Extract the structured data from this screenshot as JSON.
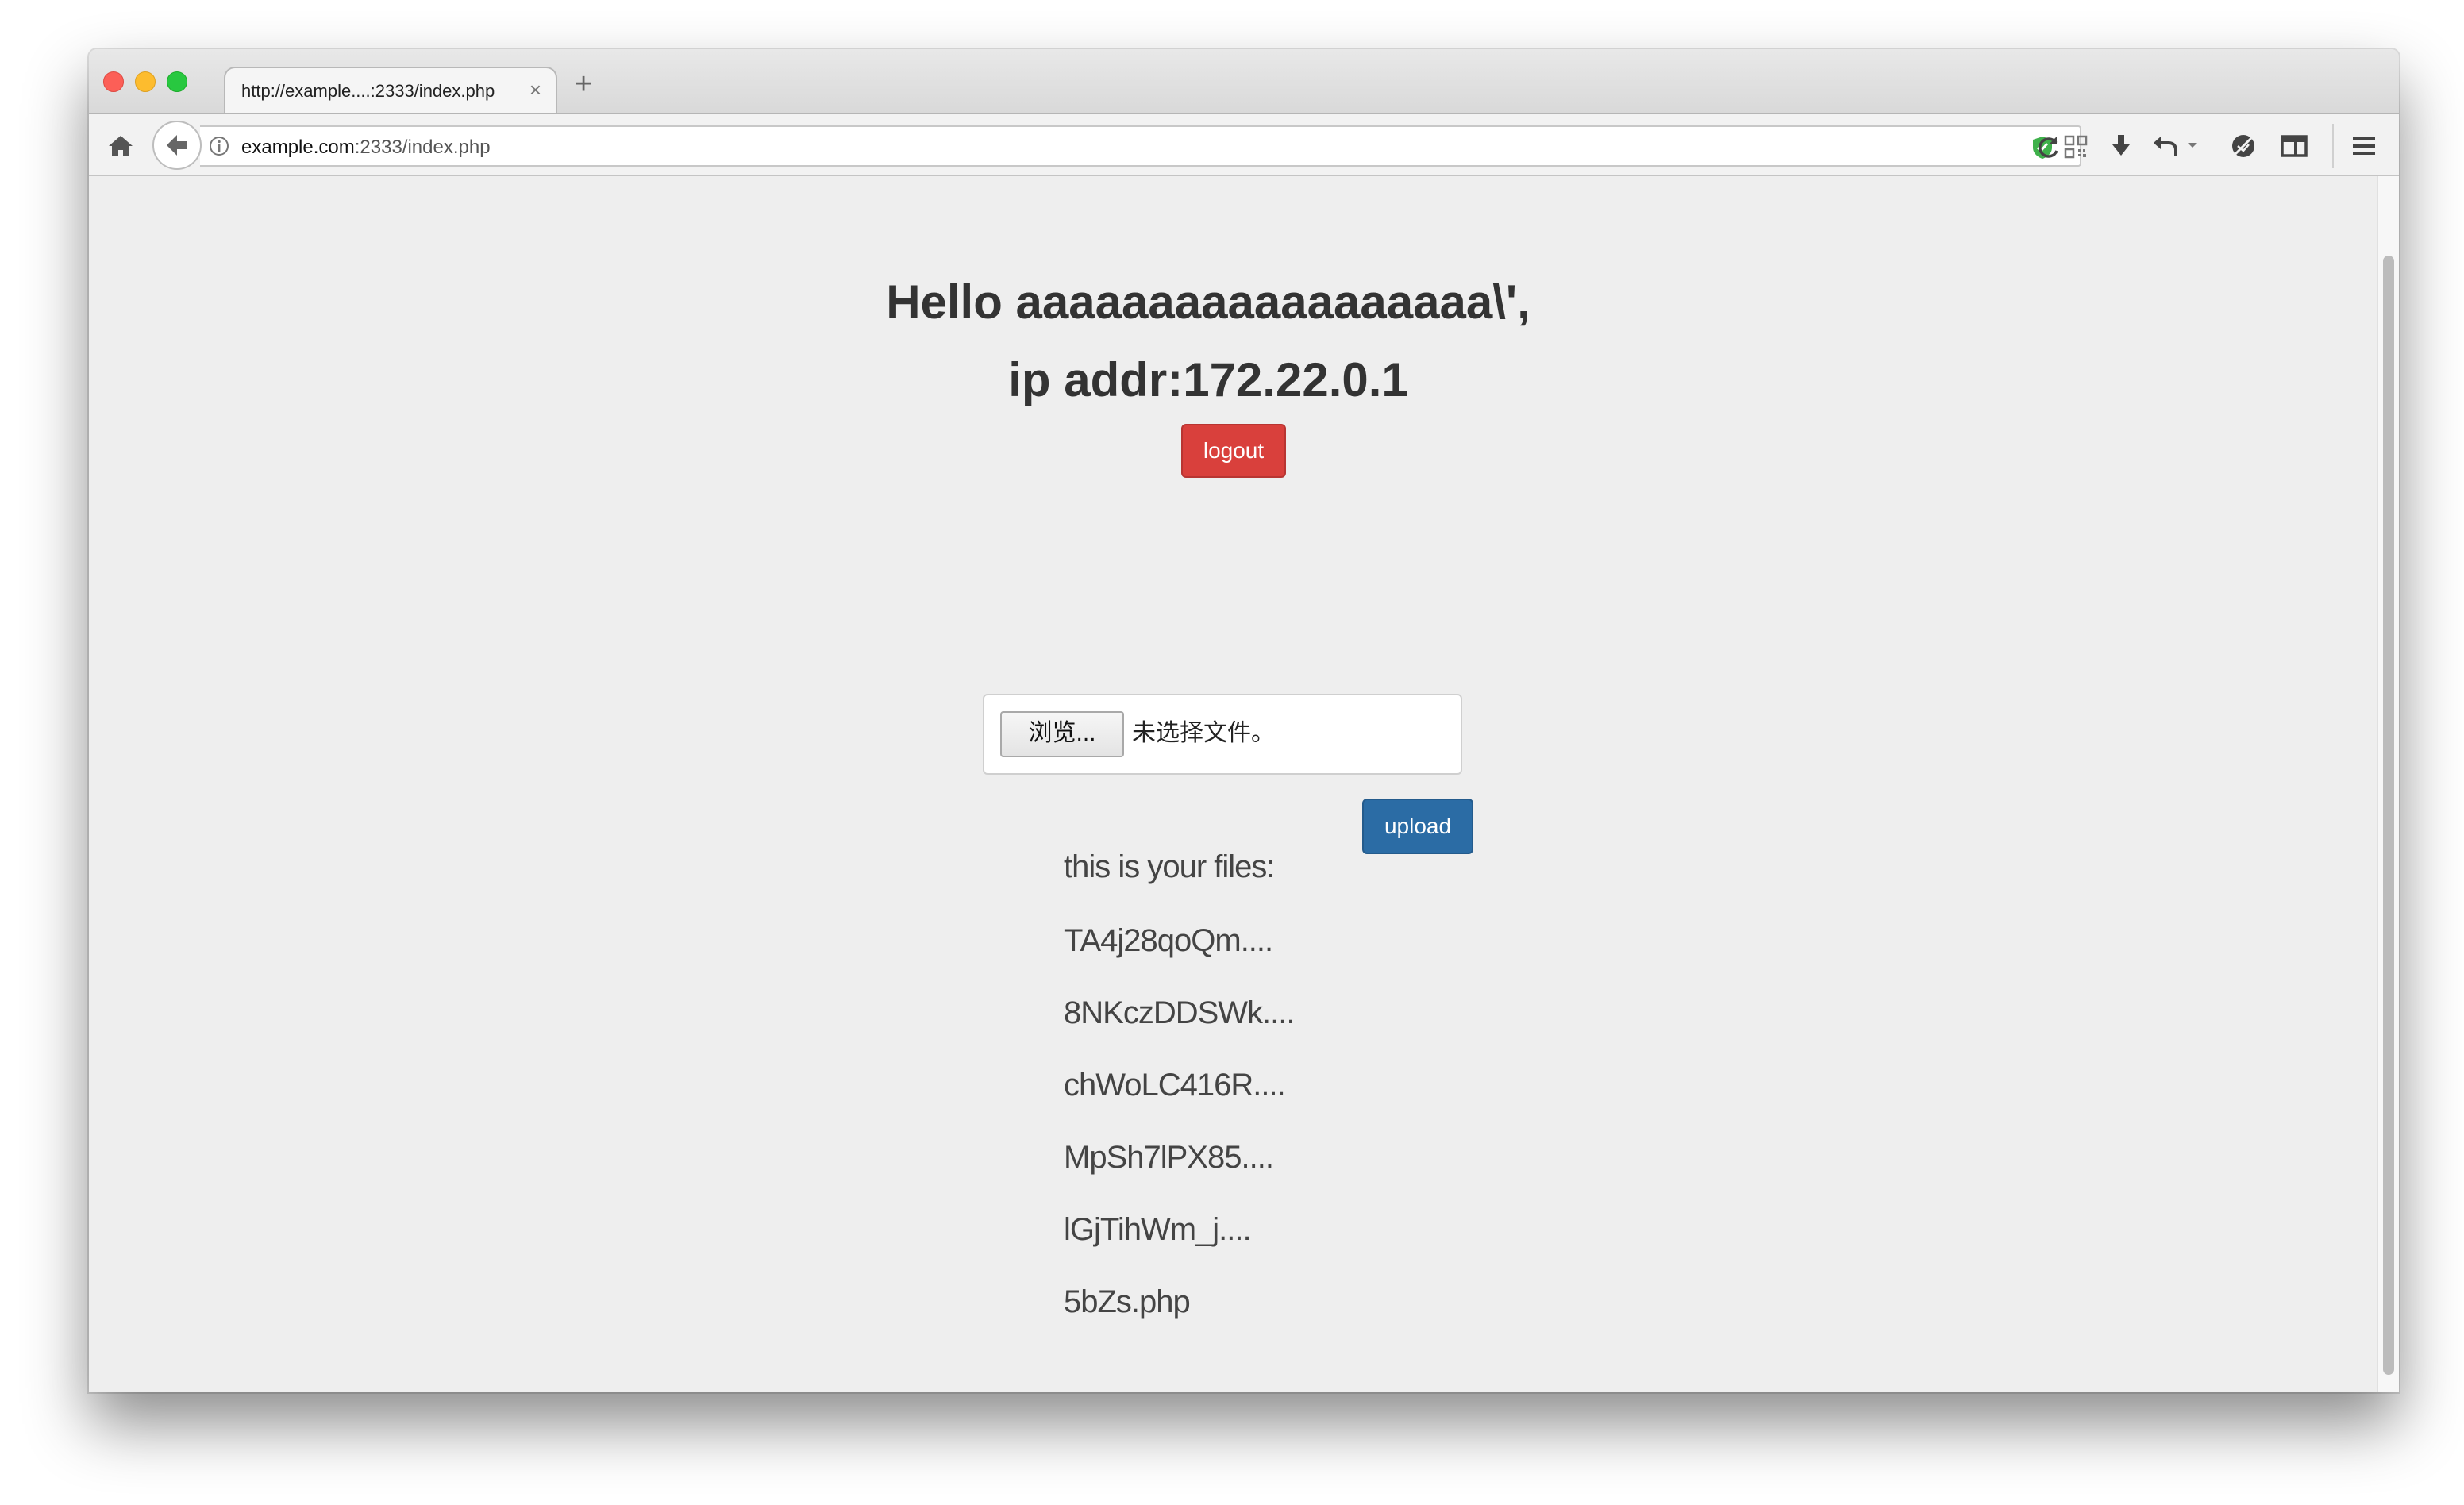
{
  "browser": {
    "tab_title": "http://example....:2333/index.php",
    "tab_close": "×",
    "new_tab": "+",
    "url_host": "example.com",
    "url_path": ":2333/index.php"
  },
  "page": {
    "greeting_line1": "Hello aaaaaaaaaaaaaaaaaa\\',",
    "greeting_line2": "ip addr:172.22.0.1",
    "logout_label": "logout",
    "browse_label": "浏览...",
    "file_status": "未选择文件。",
    "upload_label": "upload",
    "files_heading": "this is your files:",
    "files": [
      "TA4j28qoQm....",
      "8NKczDDSWk....",
      "chWoLC416R....",
      "MpSh7lPX85....",
      "lGjTihWm_j....",
      "5bZs.php"
    ]
  },
  "colors": {
    "logout": "#d9403c",
    "upload": "#2b6ca5",
    "page_background": "#eeeeee"
  },
  "icons": {
    "home": "home-icon",
    "back": "arrow-left-icon",
    "info": "info-icon",
    "shield": "shield-check-icon",
    "qr": "qr-code-icon",
    "reload": "reload-icon",
    "download": "download-icon",
    "undo": "undo-icon",
    "pocket": "pocket-icon",
    "sidebar": "sidebar-icon",
    "menu": "hamburger-menu-icon"
  }
}
